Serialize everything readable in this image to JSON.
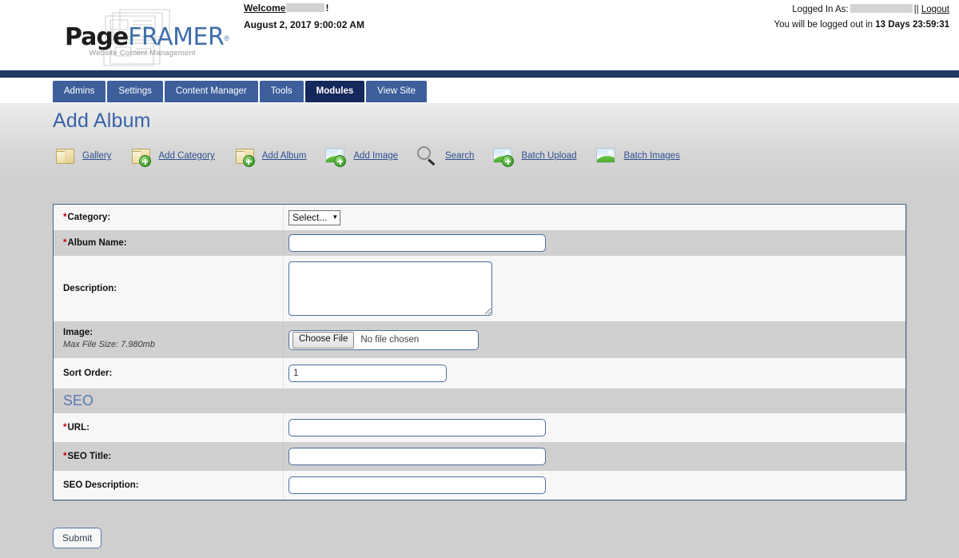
{
  "header": {
    "logo": {
      "part1": "Page",
      "part2": "FRAMER",
      "registered": "®",
      "tagline": "Website Content Management"
    },
    "welcome_label": "Welcome",
    "welcome_suffix": "!",
    "datetime": "August 2, 2017 9:00:02 AM",
    "logged_in_label": "Logged In As:",
    "separator": "||",
    "logout_label": "Logout",
    "logout_notice_prefix": "You will be logged out in",
    "logout_countdown": "13 Days 23:59:31"
  },
  "nav": {
    "tabs": [
      {
        "label": "Admins",
        "active": false
      },
      {
        "label": "Settings",
        "active": false
      },
      {
        "label": "Content Manager",
        "active": false
      },
      {
        "label": "Tools",
        "active": false
      },
      {
        "label": "Modules",
        "active": true
      },
      {
        "label": "View Site",
        "active": false
      }
    ]
  },
  "page": {
    "title": "Add Album"
  },
  "toolbar": {
    "items": [
      {
        "label": "Gallery",
        "icon": "folder-icon"
      },
      {
        "label": "Add Category",
        "icon": "folder-add-icon"
      },
      {
        "label": "Add Album",
        "icon": "folder-add-icon"
      },
      {
        "label": "Add Image",
        "icon": "picture-add-icon"
      },
      {
        "label": "Search",
        "icon": "magnifier-icon"
      },
      {
        "label": "Batch Upload",
        "icon": "picture-add-icon"
      },
      {
        "label": "Batch Images",
        "icon": "picture-icon"
      }
    ]
  },
  "form": {
    "category": {
      "label": "Category:",
      "required": "*",
      "selected": "Select...",
      "caret": "▼"
    },
    "album_name": {
      "label": "Album Name:",
      "required": "*",
      "value": "",
      "placeholder": ""
    },
    "description": {
      "label": "Description:",
      "value": "",
      "placeholder": ""
    },
    "image": {
      "label": "Image:",
      "sublabel": "Max File Size: 7.980mb",
      "button_label": "Choose File",
      "file_status": "No file chosen"
    },
    "sort_order": {
      "label": "Sort Order:",
      "value": "1"
    },
    "seo_heading": "SEO",
    "url": {
      "label": "URL:",
      "required": "*",
      "value": ""
    },
    "seo_title": {
      "label": "SEO Title:",
      "required": "*",
      "value": ""
    },
    "seo_description": {
      "label": "SEO Description:",
      "value": ""
    },
    "submit_label": "Submit"
  },
  "colors": {
    "nav_tab": "#3d5f9c",
    "nav_tab_active": "#14285c",
    "title_blue": "#3a63a8",
    "link_blue": "#2d4f8f",
    "required_red": "#cc0000",
    "table_border": "#3f6491",
    "page_bg": "#cfcfcf"
  }
}
